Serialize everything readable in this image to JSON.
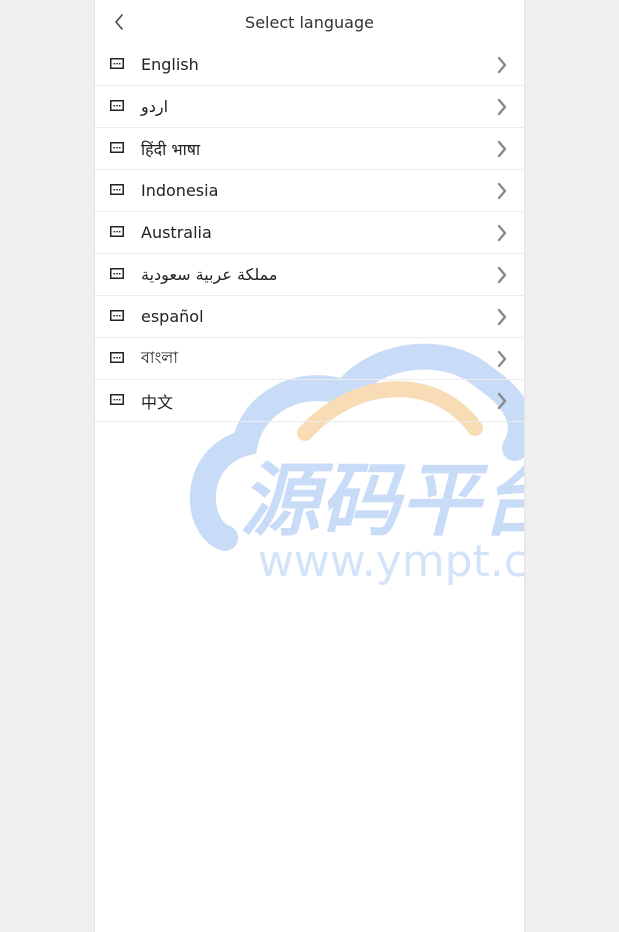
{
  "header": {
    "title": "Select language"
  },
  "languages": [
    {
      "label": "English"
    },
    {
      "label": "اردو"
    },
    {
      "label": "हिंदी भाषा"
    },
    {
      "label": "Indonesia"
    },
    {
      "label": "Australia"
    },
    {
      "label": "مملكة عربية سعودية"
    },
    {
      "label": "español"
    },
    {
      "label": "বাংলা"
    },
    {
      "label": "中文"
    }
  ],
  "icons": {
    "back": "chevron-left-icon",
    "row": "keyboard-icon",
    "row_chevron": "chevron-right-icon"
  },
  "watermark": {
    "chinese": "源码平台",
    "url": "www.ympt.cc",
    "color_primary": "#c9dcf7",
    "color_accent": "#f8dcb6"
  }
}
